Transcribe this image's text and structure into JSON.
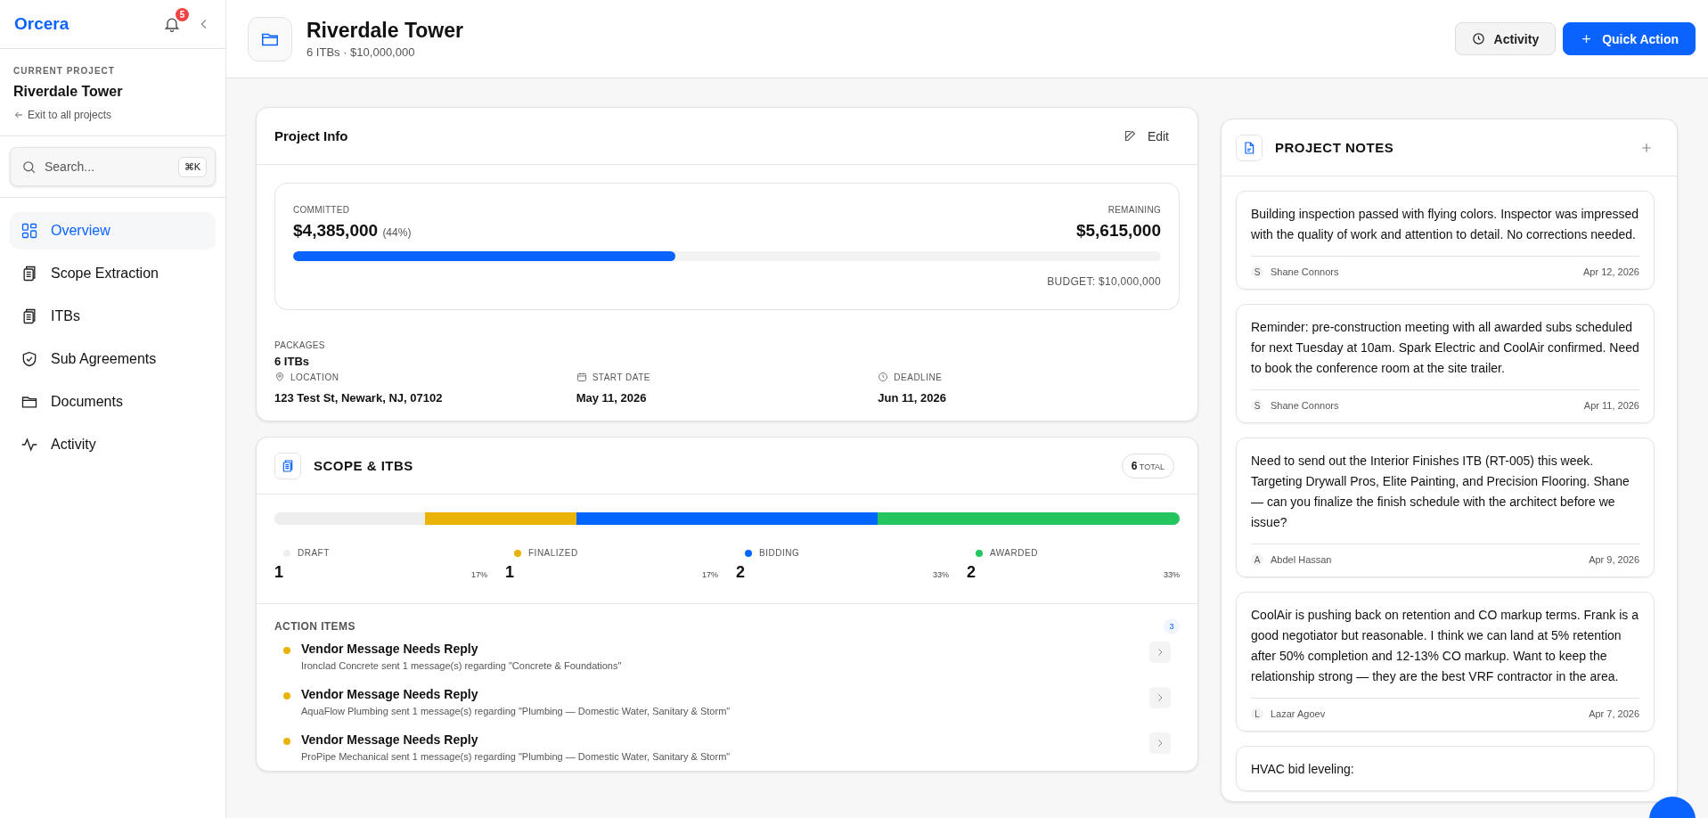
{
  "sidebar": {
    "brand": "Orcera",
    "notifications": "5",
    "current_project_label": "CURRENT PROJECT",
    "current_project": "Riverdale Tower",
    "exit_link": "Exit to all projects",
    "search": {
      "placeholder": "Search...",
      "shortcut": "⌘K"
    },
    "items": [
      {
        "label": "Overview",
        "selected": true
      },
      {
        "label": "Scope Extraction",
        "selected": false
      },
      {
        "label": "ITBs",
        "selected": false
      },
      {
        "label": "Sub Agreements",
        "selected": false
      },
      {
        "label": "Documents",
        "selected": false
      },
      {
        "label": "Activity",
        "selected": false
      }
    ]
  },
  "header": {
    "title": "Riverdale Tower",
    "subtitle": "6 ITBs · $10,000,000",
    "buttons": [
      {
        "label": "Activity",
        "kind": "secondary"
      },
      {
        "label": "Quick Action",
        "kind": "primary"
      }
    ]
  },
  "project_info": {
    "title": "Project Info",
    "edit": "Edit",
    "committed_label": "COMMITTED",
    "committed": "$4,385,000",
    "committed_pct": "(44%)",
    "remaining_label": "REMAINING",
    "remaining": "$5,615,000",
    "level": 0.44,
    "budget": "BUDGET: $10,000,000",
    "packages_label": "PACKAGES",
    "packages": "6 ITBs",
    "fields": [
      {
        "label": "LOCATION",
        "value": "123 Test St, Newark, NJ, 07102"
      },
      {
        "label": "START DATE",
        "value": "May 11, 2026"
      },
      {
        "label": "DEADLINE",
        "value": "Jun 11, 2026"
      }
    ]
  },
  "scope": {
    "title": "SCOPE & ITBS",
    "total": "6",
    "total_label": "TOTAL",
    "statuses": [
      {
        "label": "DRAFT",
        "count": "1",
        "percent": "17%",
        "color": "#eeeeee"
      },
      {
        "label": "FINALIZED",
        "count": "1",
        "percent": "17%",
        "color": "#eab308"
      },
      {
        "label": "BIDDING",
        "count": "2",
        "percent": "33%",
        "color": "#0066ff"
      },
      {
        "label": "AWARDED",
        "count": "2",
        "percent": "33%",
        "color": "#22c55e"
      }
    ],
    "action_items_label": "ACTION ITEMS",
    "action_items_count": "3",
    "action_items": [
      {
        "title": "Vendor Message Needs Reply",
        "detail": "Ironclad Concrete sent 1 message(s) regarding \"Concrete & Foundations\"",
        "color": "#eab308"
      },
      {
        "title": "Vendor Message Needs Reply",
        "detail": "AquaFlow Plumbing sent 1 message(s) regarding \"Plumbing — Domestic Water, Sanitary & Storm\"",
        "color": "#eab308"
      },
      {
        "title": "Vendor Message Needs Reply",
        "detail": "ProPipe Mechanical sent 1 message(s) regarding \"Plumbing — Domestic Water, Sanitary & Storm\"",
        "color": "#eab308"
      }
    ]
  },
  "notes": {
    "title": "PROJECT NOTES",
    "items": [
      {
        "text": "Building inspection passed with flying colors. Inspector was impressed with the quality of work and attention to detail. No corrections needed.",
        "initial": "S",
        "author": "Shane Connors",
        "date": "Apr 12, 2026"
      },
      {
        "text": "Reminder: pre-construction meeting with all awarded subs scheduled for next Tuesday at 10am. Spark Electric and CoolAir confirmed. Need to book the conference room at the site trailer.",
        "initial": "S",
        "author": "Shane Connors",
        "date": "Apr 11, 2026"
      },
      {
        "text": "Need to send out the Interior Finishes ITB (RT-005) this week. Targeting Drywall Pros, Elite Painting, and Precision Flooring. Shane — can you finalize the finish schedule with the architect before we issue?",
        "initial": "A",
        "author": "Abdel Hassan",
        "date": "Apr 9, 2026"
      },
      {
        "text": "CoolAir is pushing back on retention and CO markup terms. Frank is a good negotiator but reasonable. I think we can land at 5% retention after 50% completion and 12-13% CO markup. Want to keep the relationship strong — they are the best VRF contractor in the area.",
        "initial": "L",
        "author": "Lazar Agoev",
        "date": "Apr 7, 2026"
      },
      {
        "text": "HVAC bid leveling:"
      }
    ]
  }
}
